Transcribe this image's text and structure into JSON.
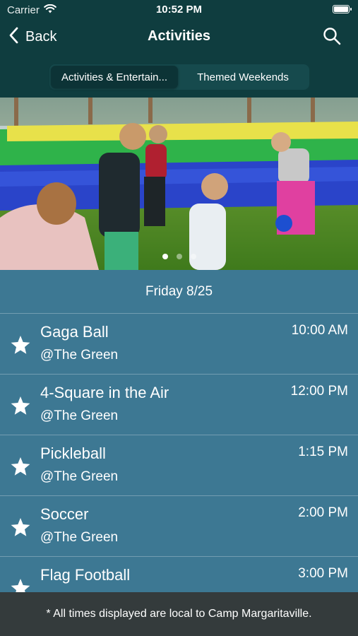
{
  "status_bar": {
    "carrier": "Carrier",
    "time": "10:52 PM"
  },
  "nav": {
    "back_label": "Back",
    "title": "Activities"
  },
  "tabs": [
    {
      "label": "Activities & Entertain..."
    },
    {
      "label": "Themed Weekends"
    }
  ],
  "hero": {
    "page_count": 3,
    "current_page": 1
  },
  "schedule": {
    "date_label": "Friday 8/25",
    "items": [
      {
        "name": "Gaga Ball",
        "location": "@The Green",
        "time": "10:00 AM"
      },
      {
        "name": "4-Square in the Air",
        "location": "@The Green",
        "time": "12:00 PM"
      },
      {
        "name": "Pickleball",
        "location": "@The Green",
        "time": "1:15 PM"
      },
      {
        "name": "Soccer",
        "location": "@The Green",
        "time": "2:00 PM"
      },
      {
        "name": "Flag Football",
        "location": "",
        "time": "3:00 PM"
      }
    ]
  },
  "footer": {
    "note": "* All times displayed are local to Camp Margaritaville."
  },
  "colors": {
    "header_bg": "#0f3d3f",
    "list_bg": "#3d7893",
    "footer_bg": "#343b3c"
  }
}
